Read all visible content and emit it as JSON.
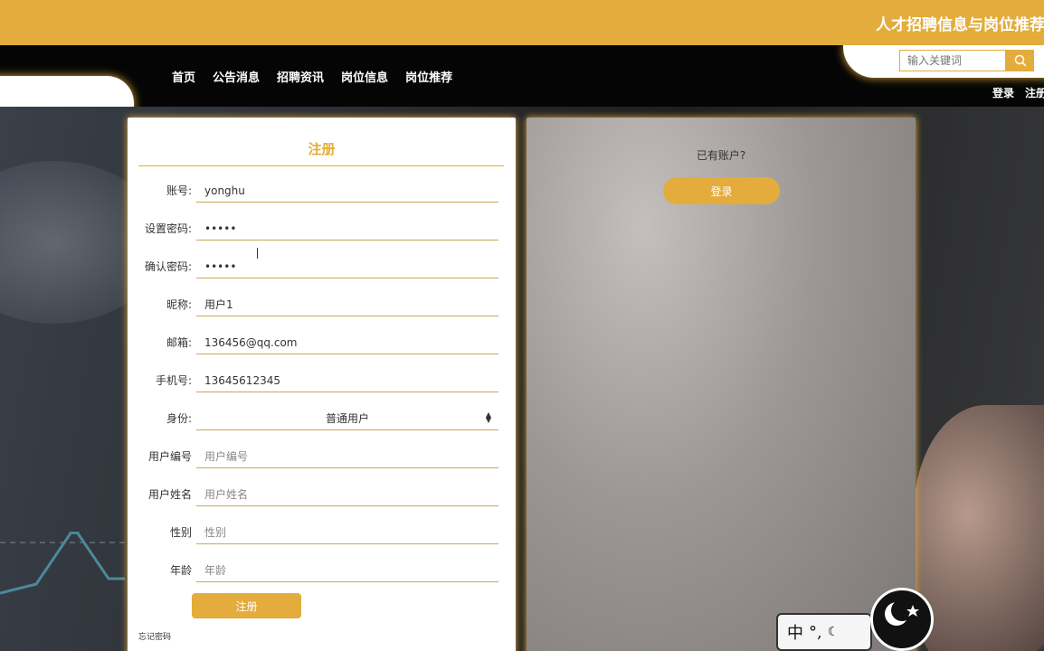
{
  "header": {
    "site_title": "人才招聘信息与岗位推荐"
  },
  "nav": {
    "items": [
      {
        "label": "首页"
      },
      {
        "label": "公告消息"
      },
      {
        "label": "招聘资讯"
      },
      {
        "label": "岗位信息"
      },
      {
        "label": "岗位推荐"
      }
    ]
  },
  "search": {
    "placeholder": "输入关键词",
    "icon": "search-icon"
  },
  "auth": {
    "login": "登录",
    "register": "注册"
  },
  "register_form": {
    "title": "注册",
    "fields": [
      {
        "label": "账号:",
        "value": "yonghu",
        "placeholder": ""
      },
      {
        "label": "设置密码:",
        "value": "•••••",
        "placeholder": ""
      },
      {
        "label": "确认密码:",
        "value": "•••••",
        "placeholder": ""
      },
      {
        "label": "昵称:",
        "value": "用户1",
        "placeholder": ""
      },
      {
        "label": "邮箱:",
        "value": "136456@qq.com",
        "placeholder": ""
      },
      {
        "label": "手机号:",
        "value": "13645612345",
        "placeholder": ""
      },
      {
        "label": "身份:",
        "value": "普通用户",
        "placeholder": ""
      },
      {
        "label": "用户编号",
        "value": "",
        "placeholder": "用户编号"
      },
      {
        "label": "用户姓名",
        "value": "",
        "placeholder": "用户姓名"
      },
      {
        "label": "性别",
        "value": "",
        "placeholder": "性别"
      },
      {
        "label": "年龄",
        "value": "",
        "placeholder": "年龄"
      }
    ],
    "submit_label": "注册",
    "forgot_label": "忘记密码"
  },
  "login_panel": {
    "prompt": "已有账户?",
    "login_button": "登录"
  },
  "ime": {
    "mode_char": "中",
    "punct": "°,"
  },
  "colors": {
    "accent": "#e3ac3c",
    "nav_bg": "#050505"
  }
}
